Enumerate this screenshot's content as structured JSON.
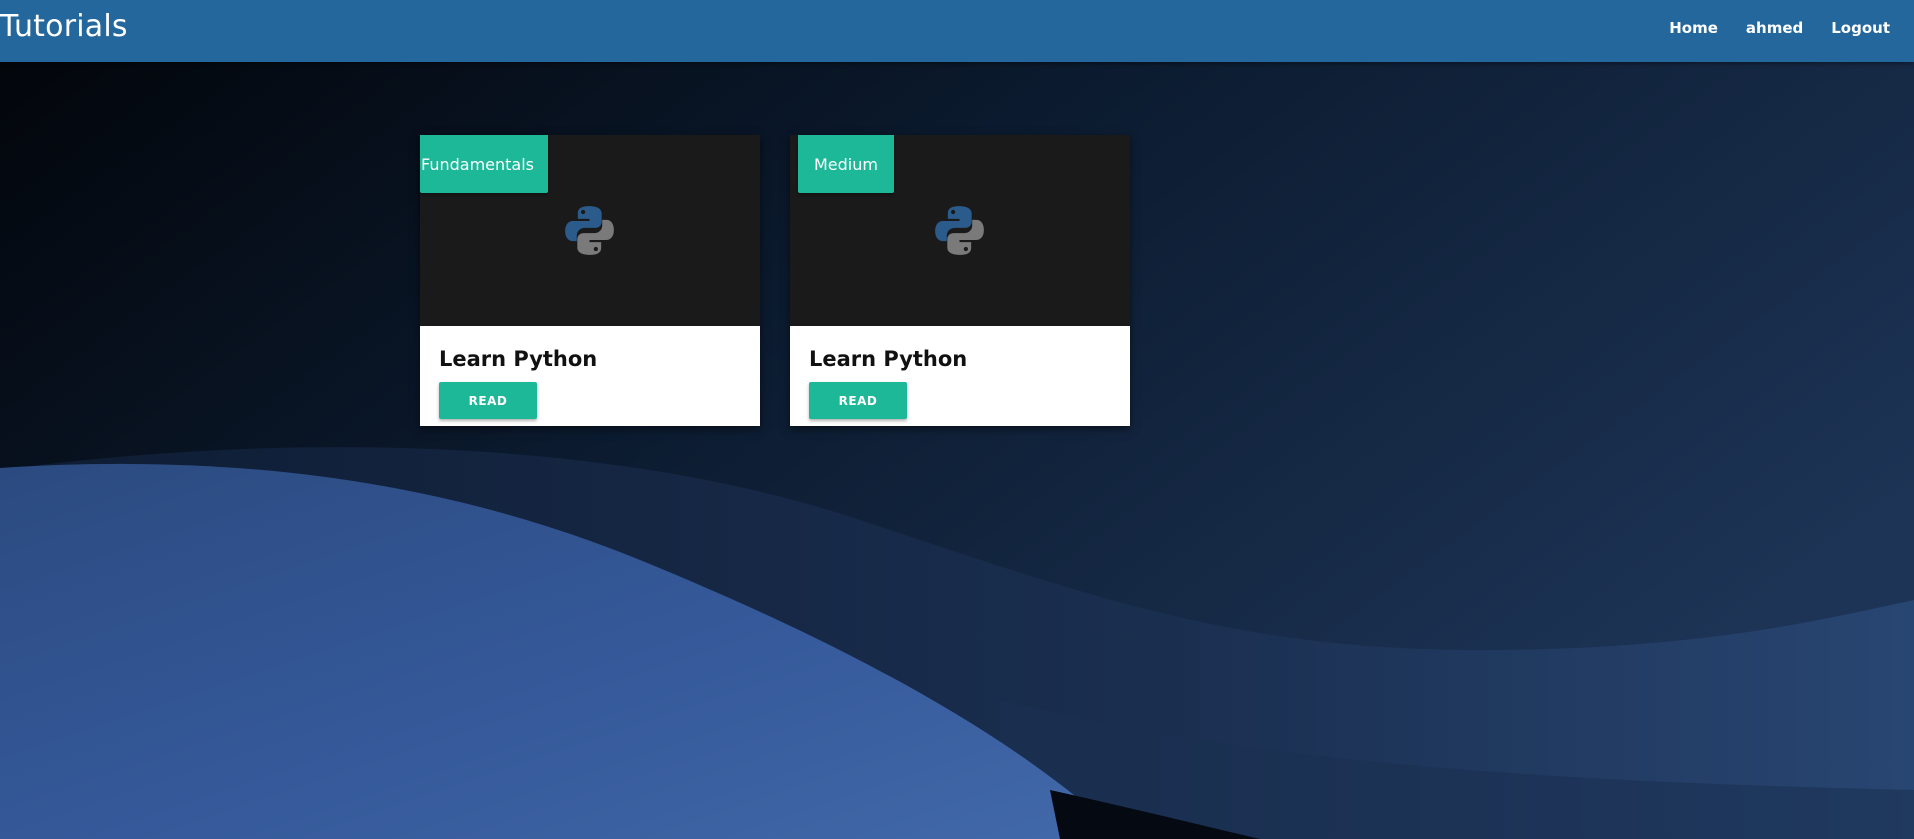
{
  "header": {
    "brand": "Tutorials",
    "nav": [
      {
        "label": "Home"
      },
      {
        "label": "ahmed"
      },
      {
        "label": "Logout"
      }
    ]
  },
  "cards": [
    {
      "badge": "Fundamentals",
      "title": "Learn Python",
      "button": "READ",
      "icon": "python-logo-icon"
    },
    {
      "badge": "Medium",
      "title": "Learn Python",
      "button": "READ",
      "icon": "python-logo-icon"
    }
  ],
  "colors": {
    "navbar": "#24679c",
    "accent": "#1cb898",
    "card_image_bg": "#1a1a1a",
    "page_bg_dark": "#03070d",
    "wave_blue": "#3d62a2"
  }
}
